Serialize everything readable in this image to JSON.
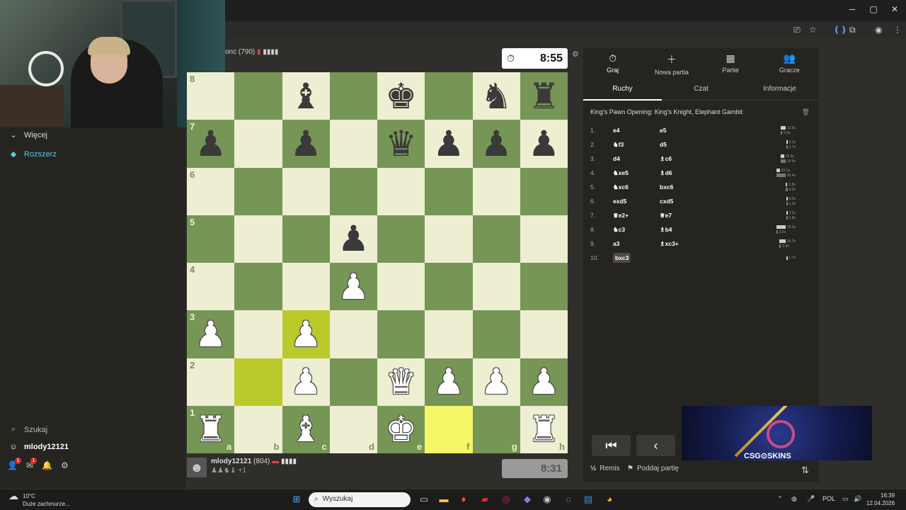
{
  "window": {
    "minimize": "─",
    "maximize": "▢",
    "close": "✕"
  },
  "sidebar": {
    "more_label": "Więcej",
    "extend_label": "Rozszerz",
    "search_label": "Szukaj",
    "username": "mlody12121",
    "notif_badges": [
      "1",
      "1"
    ]
  },
  "game": {
    "opponent_info": "onc (790)",
    "top_clock": "8:55",
    "bottom_clock": "8:31",
    "player_name": "mlody12121",
    "player_rating": "(804)",
    "captured_extra": "+1",
    "files": [
      "a",
      "b",
      "c",
      "d",
      "e",
      "f",
      "g",
      "h"
    ],
    "ranks": [
      "8",
      "7",
      "6",
      "5",
      "4",
      "3",
      "2",
      "1"
    ],
    "board": [
      [
        "",
        "",
        "bB",
        "",
        "bK",
        "",
        "bN",
        "bR"
      ],
      [
        "bP",
        "",
        "bP",
        "",
        "bQ",
        "bP",
        "bP",
        "bP"
      ],
      [
        "",
        "",
        "",
        "",
        "",
        "",
        "",
        ""
      ],
      [
        "",
        "",
        "",
        "bP",
        "",
        "",
        "",
        ""
      ],
      [
        "",
        "",
        "",
        "wP",
        "",
        "",
        "",
        ""
      ],
      [
        "wP",
        "",
        "wP",
        "",
        "",
        "",
        "",
        ""
      ],
      [
        "",
        "",
        "wP",
        "",
        "wQ",
        "wP",
        "wP",
        "wP"
      ],
      [
        "wR",
        "",
        "wB",
        "",
        "wK",
        "",
        "",
        "wR"
      ]
    ],
    "highlights": [
      [
        5,
        2
      ],
      [
        6,
        1
      ],
      [
        7,
        5
      ]
    ]
  },
  "panel": {
    "tabs": [
      {
        "icon": "⏱",
        "label": "Graj"
      },
      {
        "icon": "＋",
        "label": "Nowa partia"
      },
      {
        "icon": "▦",
        "label": "Partie"
      },
      {
        "icon": "👥",
        "label": "Gracze"
      }
    ],
    "subtabs": [
      "Ruchy",
      "Czat",
      "Informacje"
    ],
    "opening": "King's Pawn Opening: King's Knight, Elephant Gambit",
    "moves": [
      {
        "num": "1.",
        "w": "e4",
        "b": "e5",
        "t1": "13.6s",
        "t2": "2.0s"
      },
      {
        "num": "2.",
        "w": "♞f3",
        "b": "d5",
        "t1": "3.1s",
        "t2": "2.7s"
      },
      {
        "num": "3.",
        "w": "d4",
        "b": "♗c6",
        "t1": "10.5s",
        "t2": "14.5s"
      },
      {
        "num": "4.",
        "w": "♞xe5",
        "b": "♗d6",
        "t1": "10.1s",
        "t2": "26.4s"
      },
      {
        "num": "5.",
        "w": "♞xc6",
        "b": "bxc6",
        "t1": "2.8s",
        "t2": "4.3s"
      },
      {
        "num": "6.",
        "w": "exd5",
        "b": "cxd5",
        "t1": "0.5s",
        "t2": "1.3s"
      },
      {
        "num": "7.",
        "w": "♛e2+",
        "b": "♕e7",
        "t1": "3.2s",
        "t2": "1.8s"
      },
      {
        "num": "8.",
        "w": "♞c3",
        "b": "♗b4",
        "t1": "26.0s",
        "t2": "2.5s"
      },
      {
        "num": "9.",
        "w": "a3",
        "b": "♗xc3+",
        "t1": "16.7s",
        "t2": "3.5s"
      },
      {
        "num": "10.",
        "w": "bxc3",
        "b": "",
        "t1": "1.7s",
        "t2": ""
      }
    ],
    "draw_label": "Remis",
    "resign_label": "Poddaj partię",
    "draw_icon": "½"
  },
  "ad": {
    "text": "CSG⊙SKINS"
  },
  "taskbar": {
    "weather_temp": "10°C",
    "weather_desc": "Duże zachmurze...",
    "search_placeholder": "Wyszukaj",
    "lang": "POL",
    "time": "16:39",
    "date": "12.04.2026"
  }
}
